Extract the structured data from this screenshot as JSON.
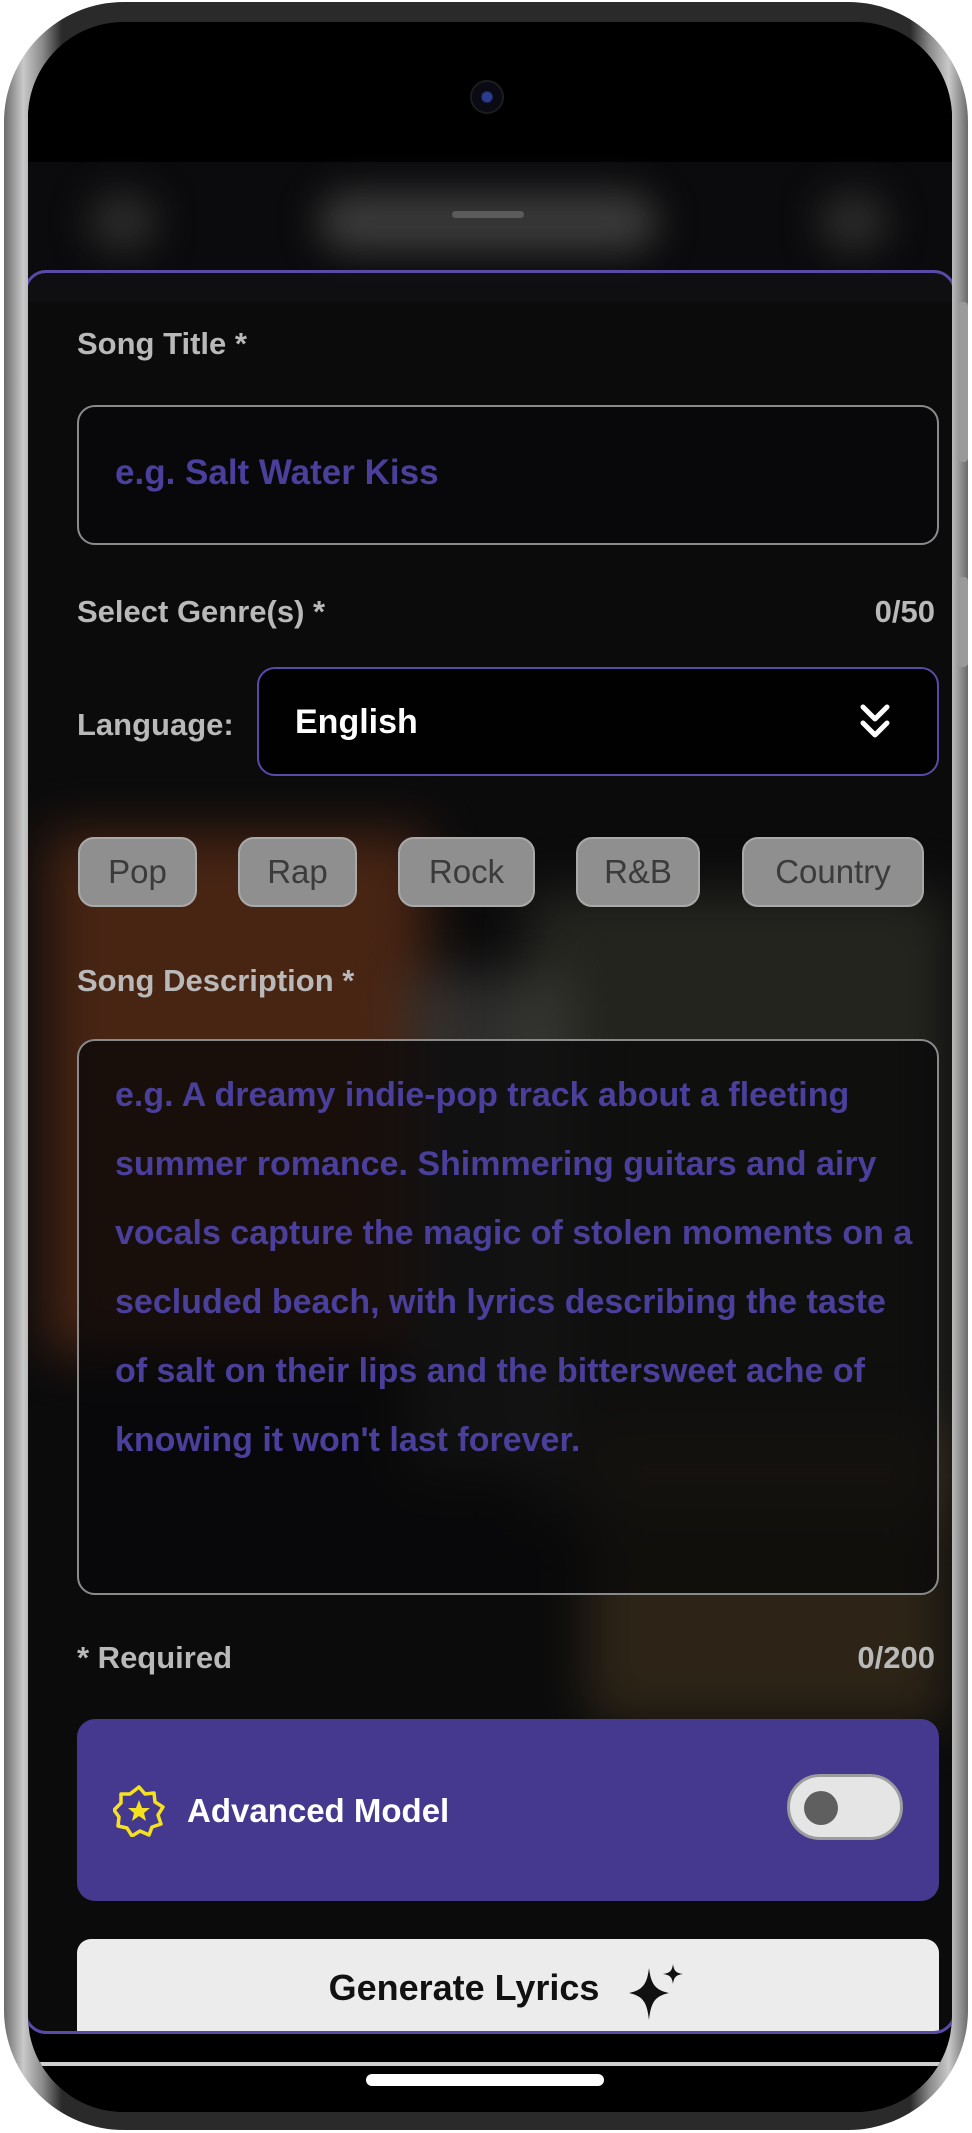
{
  "form": {
    "song_title_label": "Song Title *",
    "song_title_placeholder": "e.g. Salt Water Kiss",
    "genre_label": "Select Genre(s) *",
    "genre_counter": "0/50",
    "language_label": "Language:",
    "language_value": "English",
    "genres": [
      "Pop",
      "Rap",
      "Rock",
      "R&B",
      "Country"
    ],
    "description_label": "Song Description *",
    "description_placeholder": "e.g. A dreamy indie-pop track about a fleeting summer romance. Shimmering guitars and airy vocals capture the magic of stolen moments on a secluded beach, with lyrics describing the taste of salt on their lips and the bittersweet ache of knowing it won't last forever.",
    "required_note": "* Required",
    "description_counter": "0/200",
    "advanced_model_label": "Advanced Model",
    "advanced_model_enabled": false,
    "generate_button_label": "Generate Lyrics"
  },
  "colors": {
    "accent": "#45398f",
    "placeholder": "#4a3f9a",
    "sheet_border": "#5a4aa8",
    "star_icon": "#f5e11f"
  },
  "icons": {
    "dropdown": "double-chevron-down-icon",
    "advanced": "star-badge-icon",
    "generate": "sparkles-icon"
  }
}
